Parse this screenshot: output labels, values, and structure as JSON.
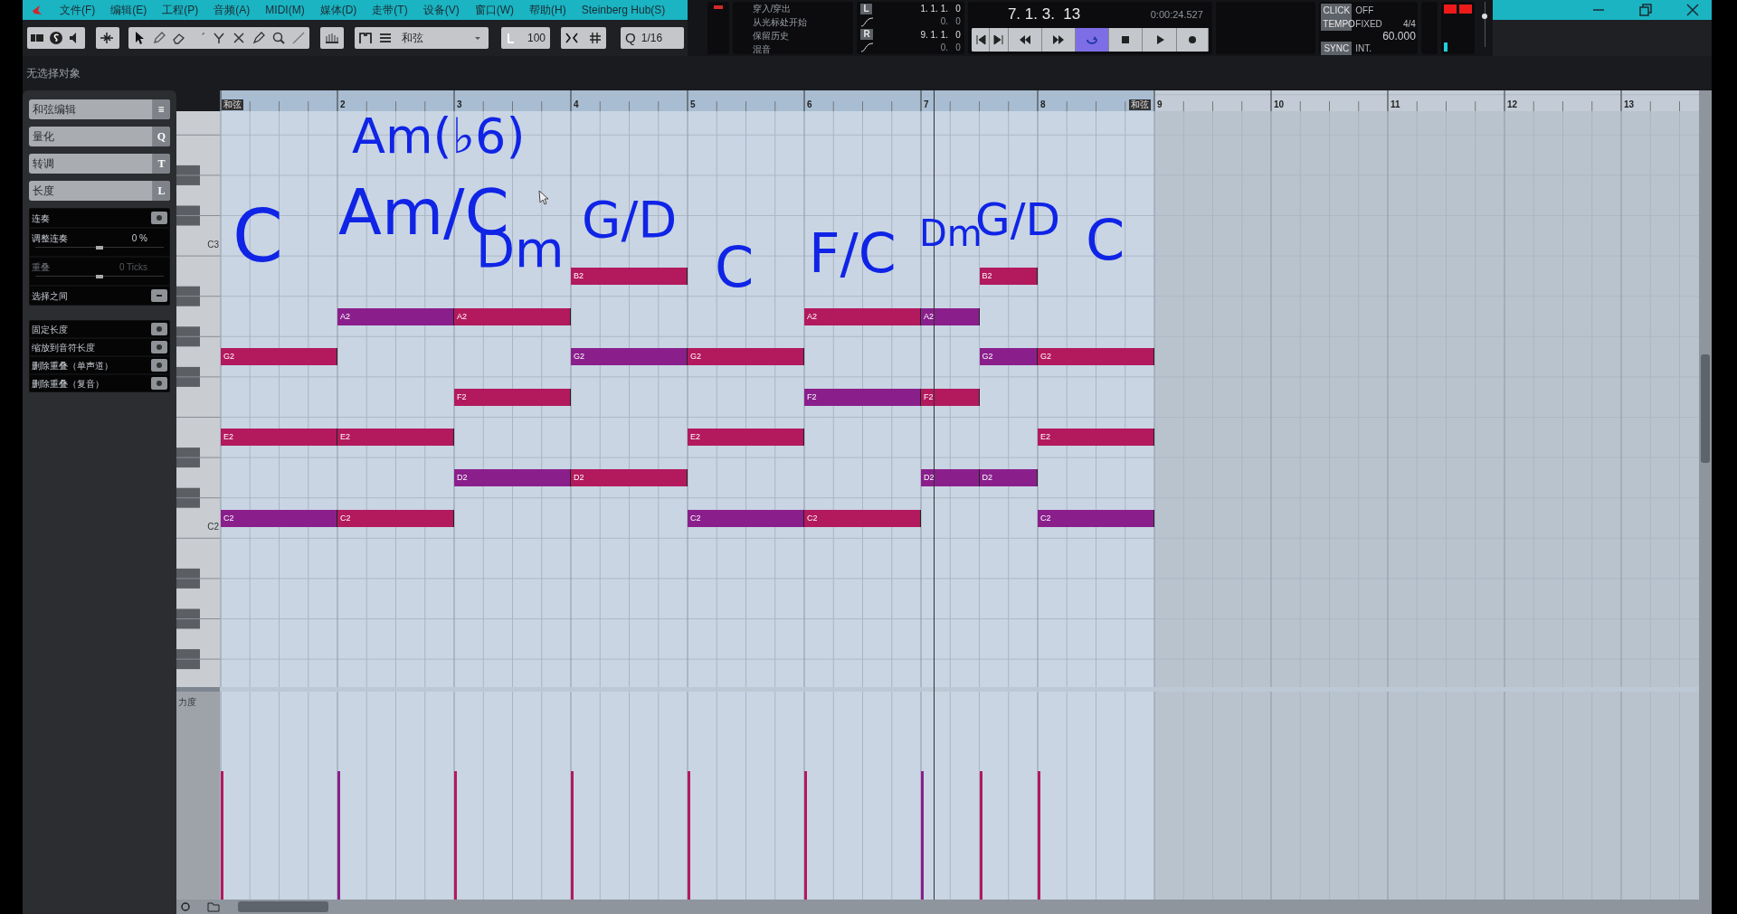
{
  "menu": [
    "文件(F)",
    "编辑(E)",
    "工程(P)",
    "音频(A)",
    "MIDI(M)",
    "媒体(D)",
    "走带(T)",
    "设备(V)",
    "窗口(W)",
    "帮助(H)",
    "Steinberg Hub(S)"
  ],
  "toolbar": {
    "chord_mode": "和弦",
    "velocity": "100",
    "quantize_label": "Q",
    "quantize": "1/16"
  },
  "status": "无选择对象",
  "transport": {
    "options": [
      "穿入/穿出",
      "从光标处开始",
      "保留历史",
      "混音"
    ],
    "left_locator": {
      "label": "L",
      "value": "1. 1. 1.   0",
      "offset": "0.   0"
    },
    "right_locator": {
      "label": "R",
      "value": "9. 1. 1.   0",
      "offset": "0.   0"
    },
    "position": "7. 1. 3.  13",
    "time": "0:00:24.527",
    "buttons": [
      {
        "kind": "start",
        "active": false
      },
      {
        "kind": "end",
        "active": false
      },
      {
        "kind": "rewind",
        "active": false
      },
      {
        "kind": "forward",
        "active": false
      },
      {
        "kind": "cycle",
        "active": true
      },
      {
        "kind": "stop",
        "active": false
      },
      {
        "kind": "play",
        "active": false
      },
      {
        "kind": "record",
        "active": false
      }
    ],
    "click": {
      "label": "CLICK",
      "value": "OFF"
    },
    "tempo": {
      "label": "TEMPO",
      "mode": "FIXED",
      "signature": "4/4",
      "value": "60.000"
    },
    "sync": {
      "label": "SYNC",
      "value": "INT."
    },
    "volume": {
      "level": 0.75
    }
  },
  "inspector": {
    "sections": [
      {
        "label": "和弦编辑",
        "key": "≡"
      },
      {
        "label": "量化",
        "key": "Q"
      },
      {
        "label": "转调",
        "key": "T"
      },
      {
        "label": "长度",
        "key": "L"
      }
    ],
    "length_rows": [
      {
        "kind": "action",
        "label": "连奏"
      },
      {
        "kind": "slider",
        "label": "调整连奏",
        "value": "0 %",
        "level": 0.5,
        "disabled": false
      },
      {
        "kind": "slider",
        "label": "重叠",
        "value": "0 Ticks",
        "level": 0.5,
        "disabled": true
      },
      {
        "kind": "menu",
        "label": "选择之间"
      }
    ],
    "actions": [
      "固定长度",
      "缩放到音符长度",
      "删除重叠（单声道）",
      "删除重叠（复音）"
    ]
  },
  "ruler": {
    "bars": [
      "2",
      "3",
      "4",
      "5",
      "6",
      "7",
      "8",
      "9",
      "10",
      "11",
      "12",
      "13"
    ],
    "part_start": "和弦",
    "part_end": "和弦"
  },
  "keyboard_labels": [
    "C3",
    "C2"
  ],
  "notes": [
    {
      "pitch": "G2",
      "color": "#b3195d"
    },
    {
      "pitch": "E2",
      "color": "#b3195d"
    },
    {
      "pitch": "C2",
      "color": "#8a1f8c"
    },
    {
      "pitch": "A2",
      "color": "#8a1f8c"
    },
    {
      "pitch": "E2",
      "color": "#b3195d"
    },
    {
      "pitch": "C2",
      "color": "#b3195d"
    },
    {
      "pitch": "A2",
      "color": "#b3195d"
    },
    {
      "pitch": "F2",
      "color": "#b3195d"
    },
    {
      "pitch": "D2",
      "color": "#8a1f8c"
    },
    {
      "pitch": "B2",
      "color": "#b3195d"
    },
    {
      "pitch": "G2",
      "color": "#8a1f8c"
    },
    {
      "pitch": "D2",
      "color": "#b3195d"
    },
    {
      "pitch": "G2",
      "color": "#b3195d"
    },
    {
      "pitch": "E2",
      "color": "#b3195d"
    },
    {
      "pitch": "C2",
      "color": "#8a1f8c"
    },
    {
      "pitch": "A2",
      "color": "#b3195d"
    },
    {
      "pitch": "F2",
      "color": "#8a1f8c"
    },
    {
      "pitch": "C2",
      "color": "#b3195d"
    },
    {
      "pitch": "A2",
      "color": "#8a1f8c"
    },
    {
      "pitch": "F2",
      "color": "#b3195d"
    },
    {
      "pitch": "D2",
      "color": "#8a1f8c"
    },
    {
      "pitch": "B2",
      "color": "#b3195d"
    },
    {
      "pitch": "G2",
      "color": "#8a1f8c"
    },
    {
      "pitch": "D2",
      "color": "#8a1f8c"
    },
    {
      "pitch": "G2",
      "color": "#b3195d"
    },
    {
      "pitch": "E2",
      "color": "#b3195d"
    },
    {
      "pitch": "C2",
      "color": "#8a1f8c"
    }
  ],
  "annotations": [
    "Am(♭6)",
    "C",
    "Am/C",
    "Dm",
    "G/D",
    "C",
    "F/C",
    "Dm",
    "G/D",
    "C"
  ],
  "velocity_lane": {
    "label": "力度"
  }
}
